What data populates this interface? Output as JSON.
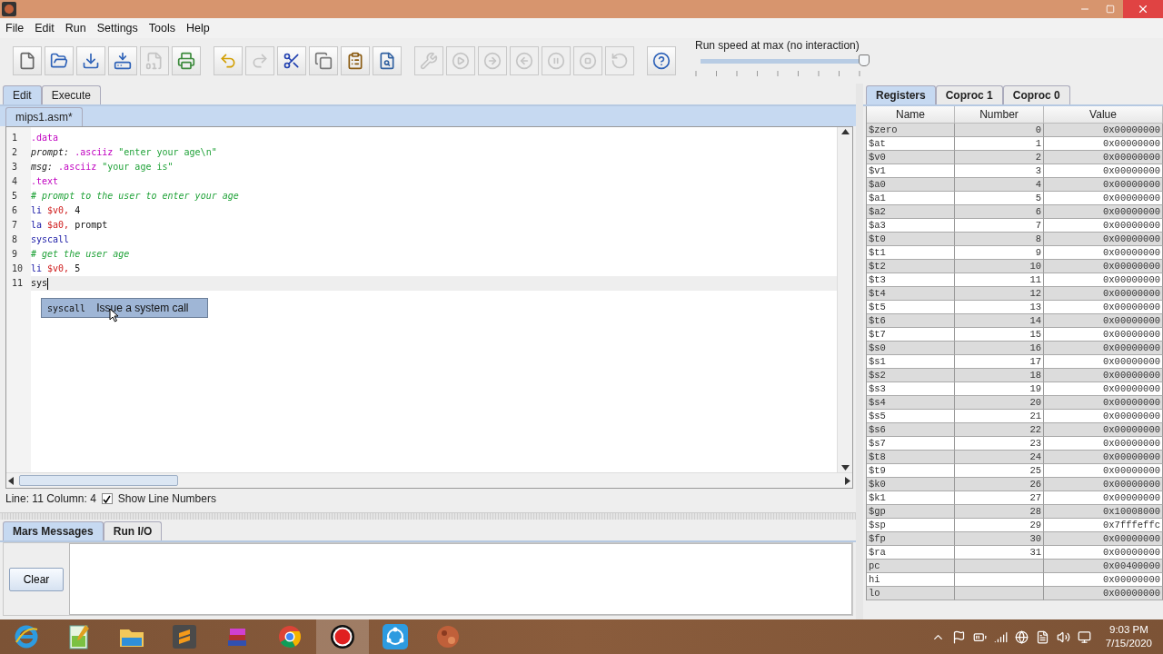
{
  "menu": [
    {
      "label": "File",
      "selected": false
    },
    {
      "label": "Edit",
      "selected": false
    },
    {
      "label": "Run",
      "selected": false
    },
    {
      "label": "Settings",
      "selected": false
    },
    {
      "label": "Tools",
      "selected": false
    },
    {
      "label": "Help",
      "selected": false
    }
  ],
  "toolbar": [
    {
      "kind": "new",
      "disabled": false
    },
    {
      "kind": "open",
      "disabled": false
    },
    {
      "kind": "save",
      "disabled": false
    },
    {
      "kind": "save-as",
      "disabled": false
    },
    {
      "kind": "dump",
      "disabled": true
    },
    {
      "kind": "print",
      "disabled": false
    },
    {
      "kind": "sep"
    },
    {
      "kind": "undo",
      "disabled": false
    },
    {
      "kind": "redo",
      "disabled": true
    },
    {
      "kind": "cut",
      "disabled": false
    },
    {
      "kind": "copy",
      "disabled": false
    },
    {
      "kind": "paste",
      "disabled": false
    },
    {
      "kind": "find",
      "disabled": false
    },
    {
      "kind": "sep"
    },
    {
      "kind": "assemble",
      "disabled": true
    },
    {
      "kind": "go",
      "disabled": true
    },
    {
      "kind": "step",
      "disabled": true
    },
    {
      "kind": "backstep",
      "disabled": true
    },
    {
      "kind": "pause",
      "disabled": true
    },
    {
      "kind": "stop",
      "disabled": true
    },
    {
      "kind": "reset",
      "disabled": true
    },
    {
      "kind": "sep"
    },
    {
      "kind": "help",
      "disabled": false
    }
  ],
  "speed": {
    "label": "Run speed at max (no interaction)",
    "level": 1
  },
  "main_tabs": [
    {
      "label": "Edit",
      "selected": true
    },
    {
      "label": "Execute",
      "selected": false
    }
  ],
  "file_tab": {
    "label": "mips1.asm*",
    "selected": true
  },
  "editor": {
    "lines": [
      {
        "number": "1",
        "tokens": [
          {
            "kind": "directive",
            "text": ".data"
          }
        ]
      },
      {
        "number": "2",
        "tokens": [
          {
            "kind": "label",
            "text": "prompt:"
          },
          {
            "kind": "directive",
            "text": ".asciiz"
          },
          {
            "kind": "string",
            "text": "\"enter your age\\n\""
          }
        ]
      },
      {
        "number": "3",
        "tokens": [
          {
            "kind": "label",
            "text": "msg:"
          },
          {
            "kind": "directive",
            "text": ".asciiz"
          },
          {
            "kind": "string",
            "text": "\"your age is\""
          }
        ]
      },
      {
        "number": "4",
        "tokens": [
          {
            "kind": "directive",
            "text": ".text"
          }
        ]
      },
      {
        "number": "5",
        "tokens": [
          {
            "kind": "comment",
            "text": "# prompt to the user to enter your age"
          }
        ]
      },
      {
        "number": "6",
        "tokens": [
          {
            "kind": "instr",
            "text": "li"
          },
          {
            "kind": "reg",
            "text": "$v0,"
          },
          {
            "kind": "plain",
            "text": "4"
          }
        ]
      },
      {
        "number": "7",
        "tokens": [
          {
            "kind": "instr",
            "text": "la"
          },
          {
            "kind": "reg",
            "text": "$a0,"
          },
          {
            "kind": "plain",
            "text": "prompt"
          }
        ]
      },
      {
        "number": "8",
        "tokens": [
          {
            "kind": "instr",
            "text": "syscall"
          }
        ]
      },
      {
        "number": "9",
        "tokens": [
          {
            "kind": "comment",
            "text": "# get the user age"
          }
        ]
      },
      {
        "number": "10",
        "tokens": [
          {
            "kind": "instr",
            "text": "li"
          },
          {
            "kind": "reg",
            "text": "$v0,"
          },
          {
            "kind": "plain",
            "text": "5"
          }
        ]
      },
      {
        "number": "11",
        "current": true,
        "tokens": [
          {
            "kind": "plain",
            "text": "sys"
          }
        ]
      }
    ],
    "autocomplete": {
      "keyword": "syscall",
      "description": "Issue a system call"
    }
  },
  "status": {
    "position": "Line: 11 Column: 4",
    "show_line_numbers": {
      "label": "Show Line Numbers",
      "checked": true
    }
  },
  "message_tabs": [
    {
      "label": "Mars Messages",
      "selected": true
    },
    {
      "label": "Run I/O",
      "selected": false
    }
  ],
  "clear_button": "Clear",
  "register_tabs": [
    {
      "label": "Registers",
      "selected": true
    },
    {
      "label": "Coproc 1",
      "selected": false
    },
    {
      "label": "Coproc 0",
      "selected": false
    }
  ],
  "registers": {
    "columns": [
      "Name",
      "Number",
      "Value"
    ],
    "rows": [
      [
        "$zero",
        "0",
        "0x00000000"
      ],
      [
        "$at",
        "1",
        "0x00000000"
      ],
      [
        "$v0",
        "2",
        "0x00000000"
      ],
      [
        "$v1",
        "3",
        "0x00000000"
      ],
      [
        "$a0",
        "4",
        "0x00000000"
      ],
      [
        "$a1",
        "5",
        "0x00000000"
      ],
      [
        "$a2",
        "6",
        "0x00000000"
      ],
      [
        "$a3",
        "7",
        "0x00000000"
      ],
      [
        "$t0",
        "8",
        "0x00000000"
      ],
      [
        "$t1",
        "9",
        "0x00000000"
      ],
      [
        "$t2",
        "10",
        "0x00000000"
      ],
      [
        "$t3",
        "11",
        "0x00000000"
      ],
      [
        "$t4",
        "12",
        "0x00000000"
      ],
      [
        "$t5",
        "13",
        "0x00000000"
      ],
      [
        "$t6",
        "14",
        "0x00000000"
      ],
      [
        "$t7",
        "15",
        "0x00000000"
      ],
      [
        "$s0",
        "16",
        "0x00000000"
      ],
      [
        "$s1",
        "17",
        "0x00000000"
      ],
      [
        "$s2",
        "18",
        "0x00000000"
      ],
      [
        "$s3",
        "19",
        "0x00000000"
      ],
      [
        "$s4",
        "20",
        "0x00000000"
      ],
      [
        "$s5",
        "21",
        "0x00000000"
      ],
      [
        "$s6",
        "22",
        "0x00000000"
      ],
      [
        "$s7",
        "23",
        "0x00000000"
      ],
      [
        "$t8",
        "24",
        "0x00000000"
      ],
      [
        "$t9",
        "25",
        "0x00000000"
      ],
      [
        "$k0",
        "26",
        "0x00000000"
      ],
      [
        "$k1",
        "27",
        "0x00000000"
      ],
      [
        "$gp",
        "28",
        "0x10008000"
      ],
      [
        "$sp",
        "29",
        "0x7fffeffc"
      ],
      [
        "$fp",
        "30",
        "0x00000000"
      ],
      [
        "$ra",
        "31",
        "0x00000000"
      ],
      [
        "pc",
        "",
        "0x00400000"
      ],
      [
        "hi",
        "",
        "0x00000000"
      ],
      [
        "lo",
        "",
        "0x00000000"
      ]
    ]
  },
  "taskbar": {
    "apps": [
      {
        "kind": "browser",
        "selected": false
      },
      {
        "kind": "notepad",
        "selected": false
      },
      {
        "kind": "folder",
        "selected": false
      },
      {
        "kind": "editor",
        "selected": false
      },
      {
        "kind": "books",
        "selected": false
      },
      {
        "kind": "chrome",
        "selected": false
      },
      {
        "kind": "recorder",
        "selected": true
      },
      {
        "kind": "share",
        "selected": false
      },
      {
        "kind": "planet",
        "selected": false
      }
    ],
    "tray": [
      {
        "kind": "up"
      },
      {
        "kind": "flag"
      },
      {
        "kind": "battery"
      },
      {
        "kind": "signal"
      },
      {
        "kind": "globe"
      },
      {
        "kind": "pdf"
      },
      {
        "kind": "volume"
      },
      {
        "kind": "monitor"
      }
    ],
    "time": "9:03 PM",
    "date": "7/15/2020"
  }
}
